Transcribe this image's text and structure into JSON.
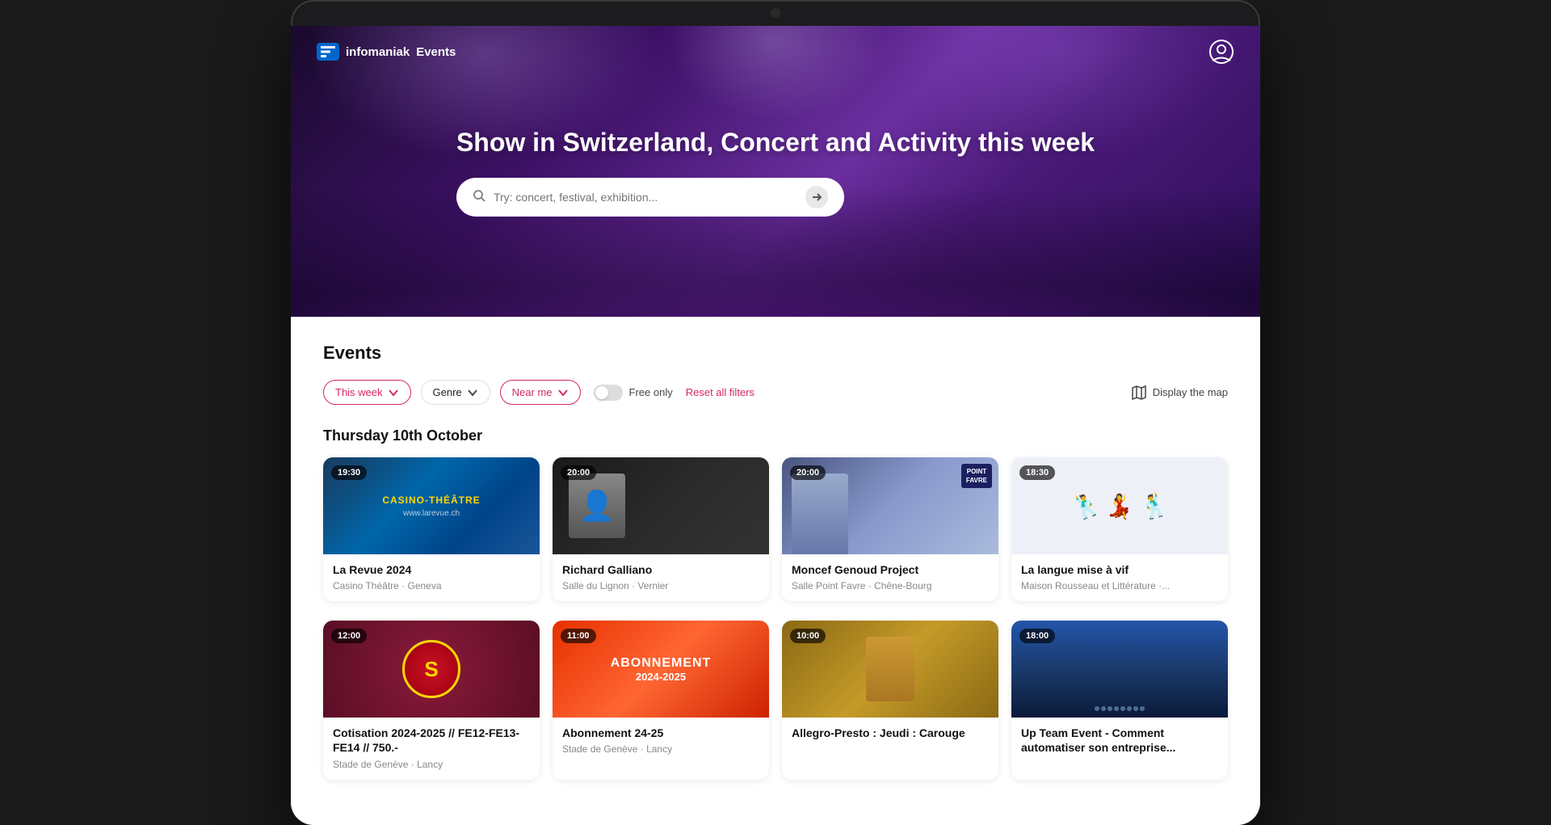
{
  "app": {
    "name": "infomaniak",
    "section": "Events"
  },
  "nav": {
    "logo_text": "infomaniak Events",
    "user_icon": "user-circle-icon"
  },
  "hero": {
    "title": "Show in Switzerland, Concert and Activity this week",
    "search_placeholder": "Try: concert, festival, exhibition..."
  },
  "events_section": {
    "title": "Events",
    "date_heading": "Thursday 10th October"
  },
  "filters": {
    "this_week_label": "This week",
    "genre_label": "Genre",
    "near_me_label": "Near me",
    "free_only_label": "Free only",
    "reset_label": "Reset all filters",
    "map_label": "Display the map"
  },
  "event_cards_row1": [
    {
      "id": 1,
      "time": "19:30",
      "title": "La Revue 2024",
      "location": "Casino Théâtre · Geneva",
      "style": "casino"
    },
    {
      "id": 2,
      "time": "20:00",
      "title": "Richard Galliano",
      "location": "Salle du Lignon · Vernier",
      "style": "richard"
    },
    {
      "id": 3,
      "time": "20:00",
      "title": "Moncef Genoud Project",
      "location": "Salle Point Favre · Chêne-Bourg",
      "style": "moncef"
    },
    {
      "id": 4,
      "time": "18:30",
      "title": "La langue mise à vif",
      "location": "Maison Rousseau et Littérature ·...",
      "style": "dance"
    }
  ],
  "event_cards_row2": [
    {
      "id": 5,
      "time": "12:00",
      "title": "Cotisation 2024-2025 // FE12-FE13-FE14 // 750.-",
      "location": "Stade de Genève · Lancy",
      "style": "servette"
    },
    {
      "id": 6,
      "time": "11:00",
      "title": "Abonnement 24-25",
      "location": "Stade de Genève · Lancy",
      "style": "abonnement"
    },
    {
      "id": 7,
      "time": "10:00",
      "title": "Allegro-Presto : Jeudi : Carouge",
      "location": "",
      "style": "allegro"
    },
    {
      "id": 8,
      "time": "18:00",
      "title": "Up Team Event - Comment automatiser son entreprise...",
      "location": "",
      "style": "upteam"
    }
  ]
}
